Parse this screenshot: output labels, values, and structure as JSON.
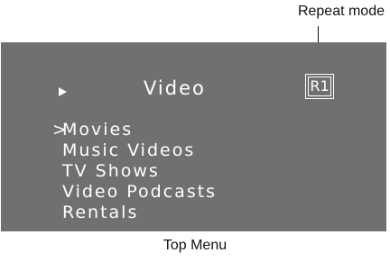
{
  "callout": {
    "label": "Repeat mode"
  },
  "screen": {
    "background": "#707070",
    "text_color": "#ffffff",
    "title": "Video",
    "play_icon": "play-triangle-icon",
    "repeat_indicator": "R1",
    "cursor": ">",
    "menu_items": [
      {
        "label": "Movies",
        "selected": true
      },
      {
        "label": "Music Videos",
        "selected": false
      },
      {
        "label": "TV Shows",
        "selected": false
      },
      {
        "label": "Video Podcasts",
        "selected": false
      },
      {
        "label": "Rentals",
        "selected": false
      }
    ]
  },
  "caption": "Top Menu"
}
